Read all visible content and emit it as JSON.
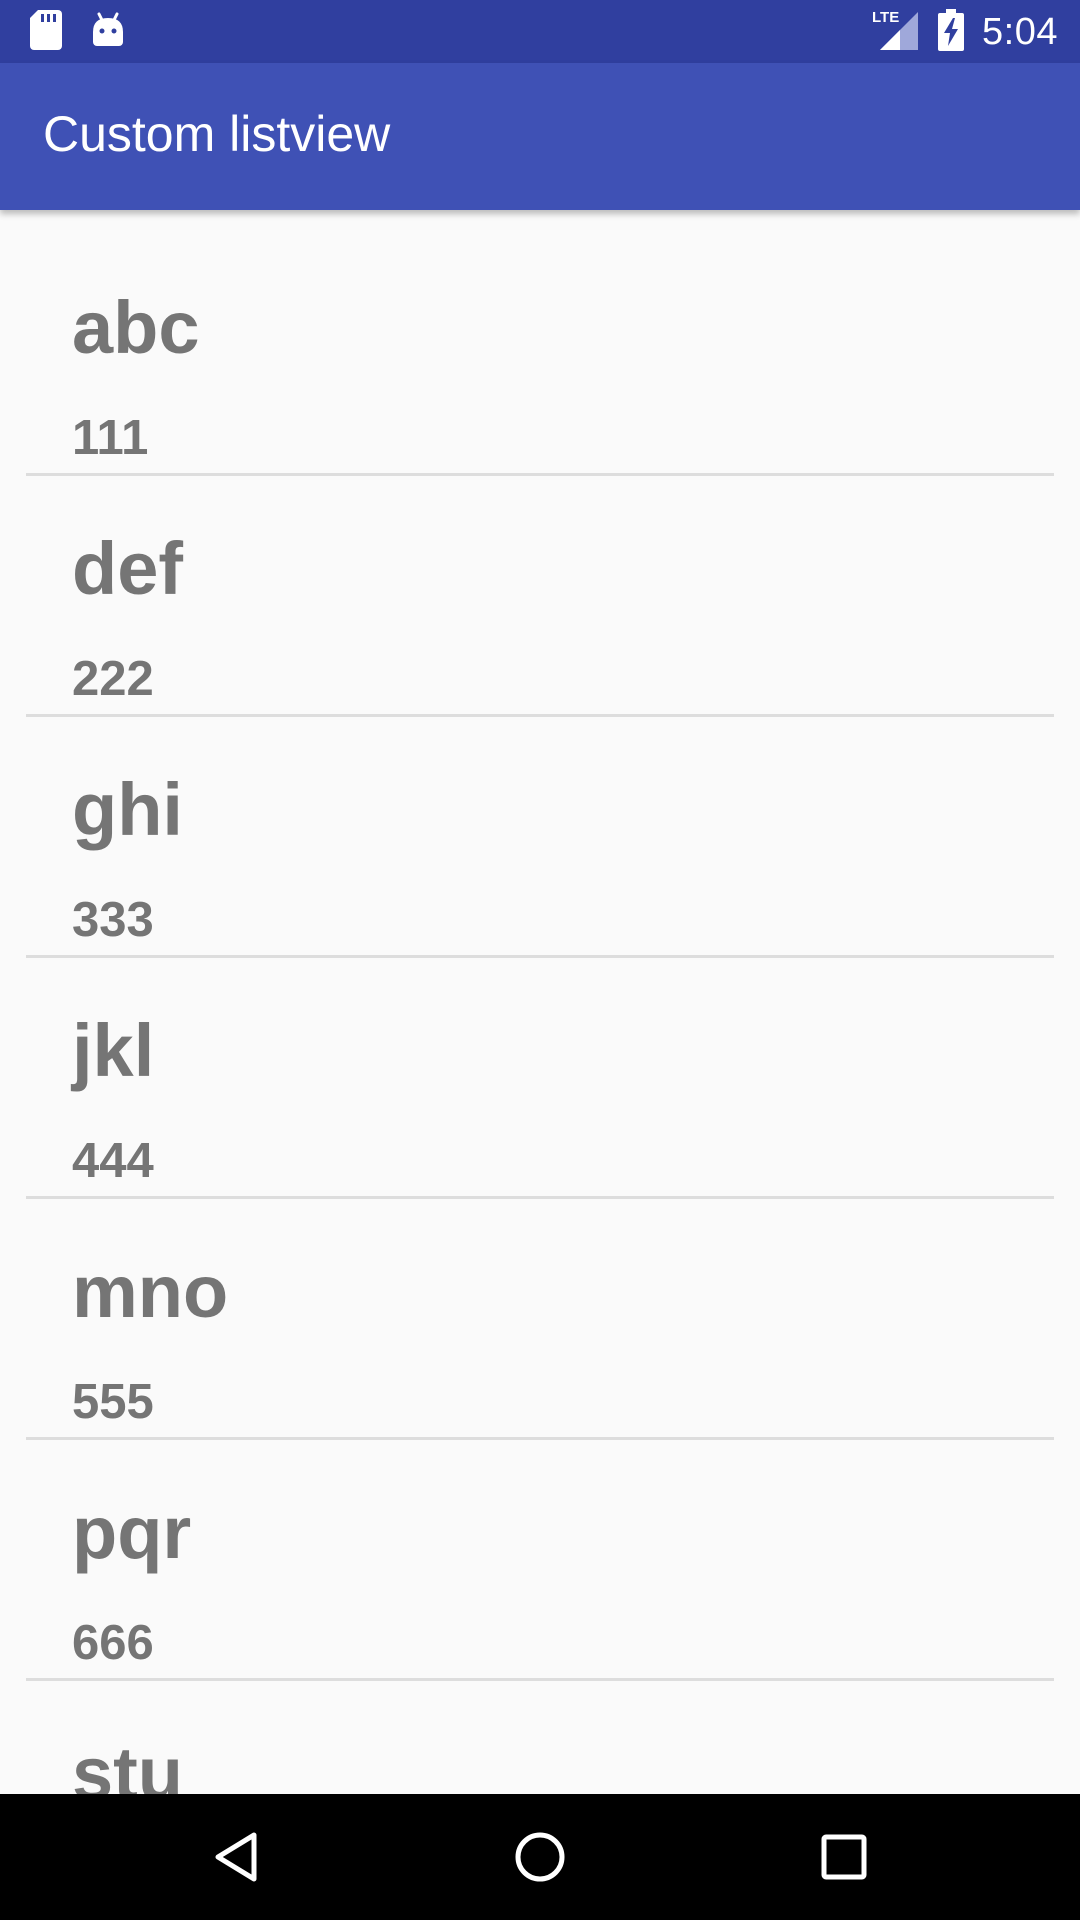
{
  "status_bar": {
    "time": "5:04",
    "network": "LTE",
    "left_icons": [
      "sd-card-icon",
      "android-icon"
    ],
    "right_icons": [
      "lte-signal-icon",
      "battery-charging-icon"
    ],
    "color": "#303f9f"
  },
  "app_bar": {
    "title": "Custom listview",
    "color": "#3f51b5"
  },
  "list": {
    "items": [
      {
        "title": "abc",
        "subtitle": "111"
      },
      {
        "title": "def",
        "subtitle": "222"
      },
      {
        "title": "ghi",
        "subtitle": "333"
      },
      {
        "title": "jkl",
        "subtitle": "444"
      },
      {
        "title": "mno",
        "subtitle": "555"
      },
      {
        "title": "pqr",
        "subtitle": "666"
      },
      {
        "title": "stu",
        "subtitle": ""
      }
    ],
    "text_color": "#757575",
    "divider_color": "#dddddd"
  },
  "nav_bar": {
    "buttons": [
      "back-icon",
      "home-icon",
      "recents-icon"
    ]
  }
}
